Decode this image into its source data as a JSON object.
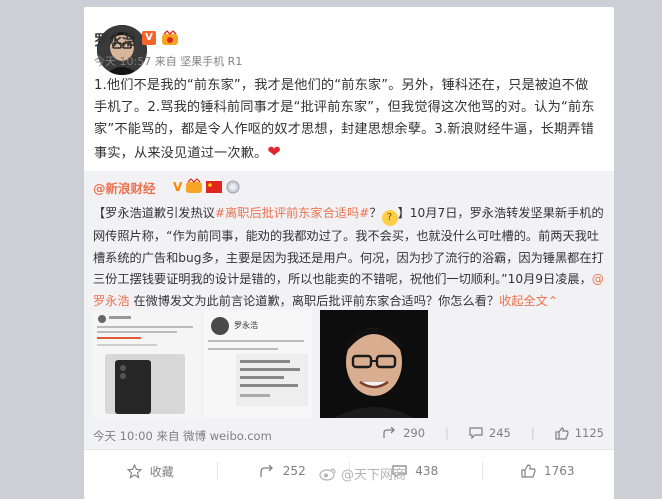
{
  "post": {
    "author": "罗永浩",
    "vip_badge": "V",
    "meta": "今天 10:57 来自 坚果手机 R1",
    "text": "1.他们不是我的“前东家”，我才是他们的“前东家”。另外，锤科还在，只是被迫不做手机了。2.骂我的锤科前同事才是“批评前东家”，但我觉得这次他骂的对。认为“前东家”不能骂的，都是令人作呕的奴才思想，封建思想余孽。3.新浪财经牛逼，长期弄错事实，从来没见道过一次歉。",
    "heart": "❤"
  },
  "repost": {
    "author": "@新浪财经",
    "v_badge": "V",
    "text_open": "【罗永浩道歉引发热议",
    "hashtag": "#离职后批评前东家合适吗#",
    "text_close": "？",
    "emoji": "?",
    "body": "】10月7日，罗永浩转发坚果新手机的网传照片称，“作为前同事，能劝的我都劝过了。我不会买，也就没什么可吐槽的。前两天我吐槽系统的广告和bug多，主要是因为我还是用户。何况，因为抄了流行的浴霸，因为锤黑都在打三份工摆钱要证明我的设计是错的，所以也能卖的不错呢，祝他们一切顺利。”10月9日凌晨，",
    "mention": "@罗永浩",
    "tail": " 在微博发文为此前言论道歉，离职后批评前东家合适吗？你怎么看？",
    "expand": "收起全文",
    "expand_arrow": "⌃",
    "time": "今天 10:00 来自 微博 weibo.com",
    "reposts": "290",
    "comments": "245",
    "likes": "1125",
    "thumb2_name": "罗永浩"
  },
  "actions": {
    "favorite": "收藏",
    "repost": "252",
    "comment": "438",
    "like": "1763"
  },
  "watermark": "@天下网商",
  "colors": {
    "accent": "#eb7350",
    "vip": "#f3652b",
    "muted": "#808080"
  }
}
